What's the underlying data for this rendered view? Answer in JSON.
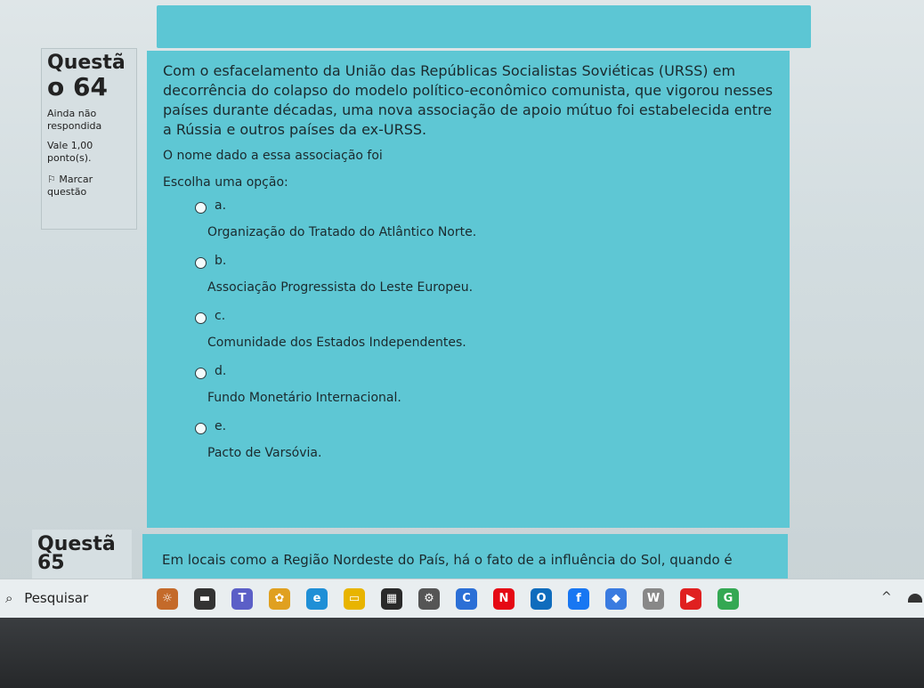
{
  "question": {
    "label": "Questã",
    "number": "o 64",
    "status": "Ainda não respondida",
    "value": "Vale 1,00 ponto(s).",
    "flag_label": "Marcar questão",
    "text": "Com o esfacelamento da União das Repúblicas Socialistas Soviéticas (URSS) em decorrência do colapso do modelo político-econômico comunista, que vigorou nesses países durante décadas, uma nova associação de apoio mútuo foi estabelecida entre a Rússia e outros países da ex-URSS.",
    "prompt": "O nome dado a essa associação foi",
    "choose_label": "Escolha uma opção:",
    "options": [
      {
        "letter": "a.",
        "text": "Organização do Tratado do Atlântico Norte."
      },
      {
        "letter": "b.",
        "text": "Associação Progressista do Leste Europeu."
      },
      {
        "letter": "c.",
        "text": "Comunidade dos Estados Independentes."
      },
      {
        "letter": "d.",
        "text": "Fundo Monetário Internacional."
      },
      {
        "letter": "e.",
        "text": "Pacto de Varsóvia."
      }
    ]
  },
  "next_question": {
    "label": "Questã",
    "number": "65",
    "text": "Em locais como a Região Nordeste do País, há o fato de a influência do Sol, quando é"
  },
  "taskbar": {
    "search_label": "Pesquisar",
    "search_icon": "search-icon",
    "apps": [
      {
        "icon": "widgets-icon",
        "color": "#c46a2a",
        "glyph": "☼"
      },
      {
        "icon": "task-view-icon",
        "color": "#333333",
        "glyph": "▬"
      },
      {
        "icon": "teams-icon",
        "color": "#5b5fc7",
        "glyph": "T"
      },
      {
        "icon": "copilot-icon",
        "color": "#e0a020",
        "glyph": "✿"
      },
      {
        "icon": "edge-icon",
        "color": "#1f8fd6",
        "glyph": "e"
      },
      {
        "icon": "file-explorer-icon",
        "color": "#e8b400",
        "glyph": "▭"
      },
      {
        "icon": "store-icon",
        "color": "#2a2a2a",
        "glyph": "▦"
      },
      {
        "icon": "settings-icon",
        "color": "#555555",
        "glyph": "⚙"
      },
      {
        "icon": "cortana-icon",
        "color": "#2b6fd6",
        "glyph": "C"
      },
      {
        "icon": "netflix-icon",
        "color": "#e50914",
        "glyph": "N"
      },
      {
        "icon": "outlook-icon",
        "color": "#0f6cbd",
        "glyph": "O"
      },
      {
        "icon": "facebook-icon",
        "color": "#1877f2",
        "glyph": "f"
      },
      {
        "icon": "copilot-app-icon",
        "color": "#3a7be0",
        "glyph": "◆"
      },
      {
        "icon": "word-icon",
        "color": "#888888",
        "glyph": "W"
      },
      {
        "icon": "youtube-icon",
        "color": "#e02020",
        "glyph": "▶"
      },
      {
        "icon": "chrome-icon",
        "color": "#34a853",
        "glyph": "G"
      }
    ],
    "chevron": "^"
  }
}
